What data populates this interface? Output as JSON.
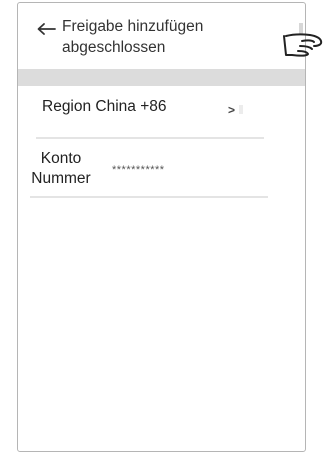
{
  "header": {
    "back_icon": "arrow-left-icon",
    "title_line1": "Freigabe hinzufügen",
    "title_line2": "abgeschlossen"
  },
  "region": {
    "label": "Region China +86",
    "chevron": ">"
  },
  "account": {
    "label_line1": "Konto",
    "label_line2": "Nummer",
    "value": "***********"
  },
  "annotation": {
    "icon": "pointing-hand-icon"
  }
}
